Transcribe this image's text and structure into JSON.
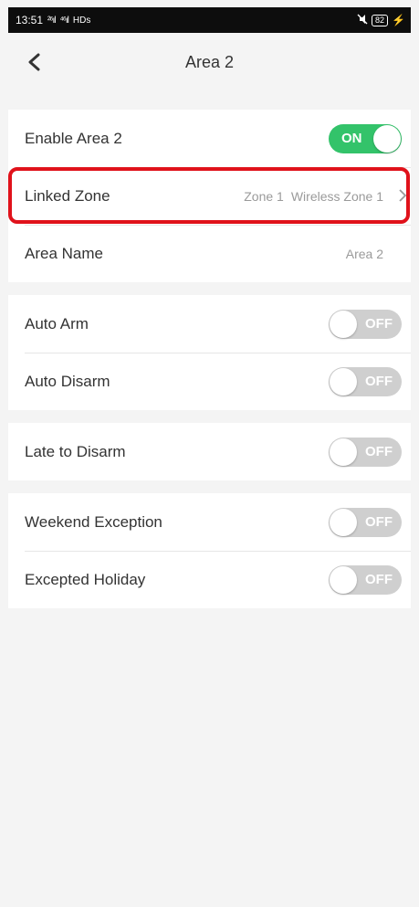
{
  "status_bar": {
    "time": "13:51",
    "signal1": "²⁶ıl",
    "signal2": "⁴⁶ıl",
    "network": "HDs",
    "battery": "82"
  },
  "header": {
    "title": "Area 2"
  },
  "groups": {
    "main": {
      "enable": {
        "label": "Enable Area 2",
        "toggle": "ON"
      },
      "linked_zone": {
        "label": "Linked Zone",
        "value1": "Zone 1",
        "value2": "Wireless Zone 1"
      },
      "area_name": {
        "label": "Area Name",
        "value": "Area 2"
      }
    },
    "auto": {
      "auto_arm": {
        "label": "Auto Arm",
        "toggle": "OFF"
      },
      "auto_disarm": {
        "label": "Auto Disarm",
        "toggle": "OFF"
      }
    },
    "late": {
      "late_to_disarm": {
        "label": "Late to Disarm",
        "toggle": "OFF"
      }
    },
    "exceptions": {
      "weekend": {
        "label": "Weekend Exception",
        "toggle": "OFF"
      },
      "holiday": {
        "label": "Excepted Holiday",
        "toggle": "OFF"
      }
    }
  },
  "colors": {
    "toggle_on": "#33c36a",
    "toggle_off": "#cfcfcf",
    "highlight": "#e0121b"
  }
}
